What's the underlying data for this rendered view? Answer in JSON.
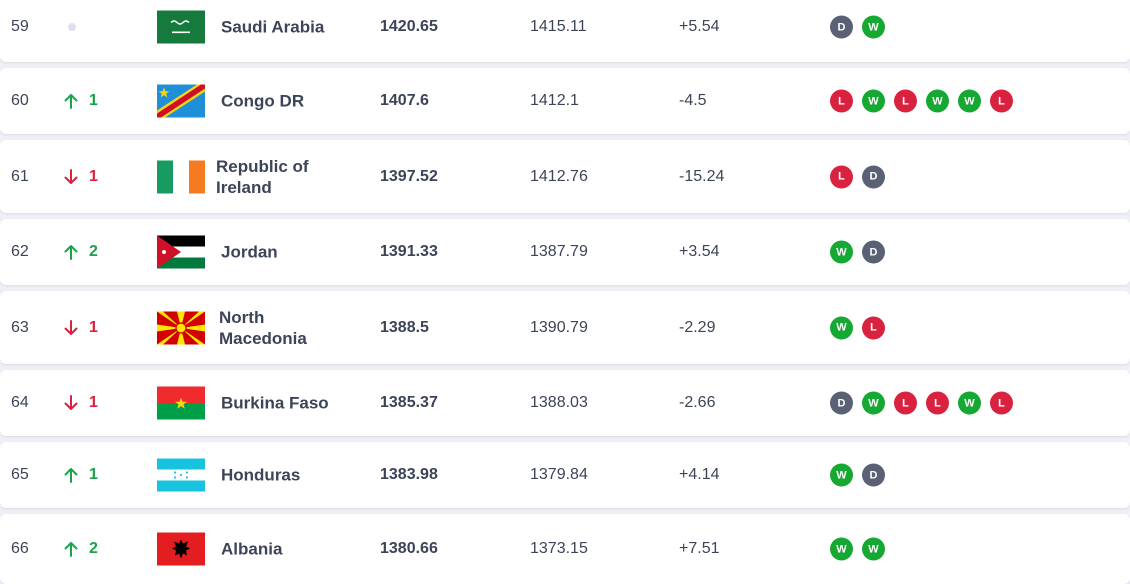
{
  "rankings": [
    {
      "rank": "59",
      "move_dir": "none",
      "move": "",
      "team": "Saudi Arabia",
      "flag_icon": "saudi-arabia-flag-icon",
      "points": "1420.65",
      "previous_points": "1415.11",
      "change": "+5.54",
      "form": [
        "D",
        "W"
      ]
    },
    {
      "rank": "60",
      "move_dir": "up",
      "move": "1",
      "team": "Congo DR",
      "flag_icon": "congo-dr-flag-icon",
      "points": "1407.6",
      "previous_points": "1412.1",
      "change": "-4.5",
      "form": [
        "L",
        "W",
        "L",
        "W",
        "W",
        "L"
      ]
    },
    {
      "rank": "61",
      "move_dir": "down",
      "move": "1",
      "team": "Republic of Ireland",
      "flag_icon": "ireland-flag-icon",
      "points": "1397.52",
      "previous_points": "1412.76",
      "change": "-15.24",
      "form": [
        "L",
        "D"
      ]
    },
    {
      "rank": "62",
      "move_dir": "up",
      "move": "2",
      "team": "Jordan",
      "flag_icon": "jordan-flag-icon",
      "points": "1391.33",
      "previous_points": "1387.79",
      "change": "+3.54",
      "form": [
        "W",
        "D"
      ]
    },
    {
      "rank": "63",
      "move_dir": "down",
      "move": "1",
      "team": "North Macedonia",
      "flag_icon": "north-macedonia-flag-icon",
      "points": "1388.5",
      "previous_points": "1390.79",
      "change": "-2.29",
      "form": [
        "W",
        "L"
      ]
    },
    {
      "rank": "64",
      "move_dir": "down",
      "move": "1",
      "team": "Burkina Faso",
      "flag_icon": "burkina-faso-flag-icon",
      "points": "1385.37",
      "previous_points": "1388.03",
      "change": "-2.66",
      "form": [
        "D",
        "W",
        "L",
        "L",
        "W",
        "L"
      ]
    },
    {
      "rank": "65",
      "move_dir": "up",
      "move": "1",
      "team": "Honduras",
      "flag_icon": "honduras-flag-icon",
      "points": "1383.98",
      "previous_points": "1379.84",
      "change": "+4.14",
      "form": [
        "W",
        "D"
      ]
    },
    {
      "rank": "66",
      "move_dir": "up",
      "move": "2",
      "team": "Albania",
      "flag_icon": "albania-flag-icon",
      "points": "1380.66",
      "previous_points": "1373.15",
      "change": "+7.51",
      "form": [
        "W",
        "W"
      ]
    }
  ],
  "colors": {
    "up": "#1aa34a",
    "down": "#d8223f",
    "win": "#15a832",
    "loss": "#d8223f",
    "draw": "#5a6175",
    "text": "#3c4457"
  }
}
